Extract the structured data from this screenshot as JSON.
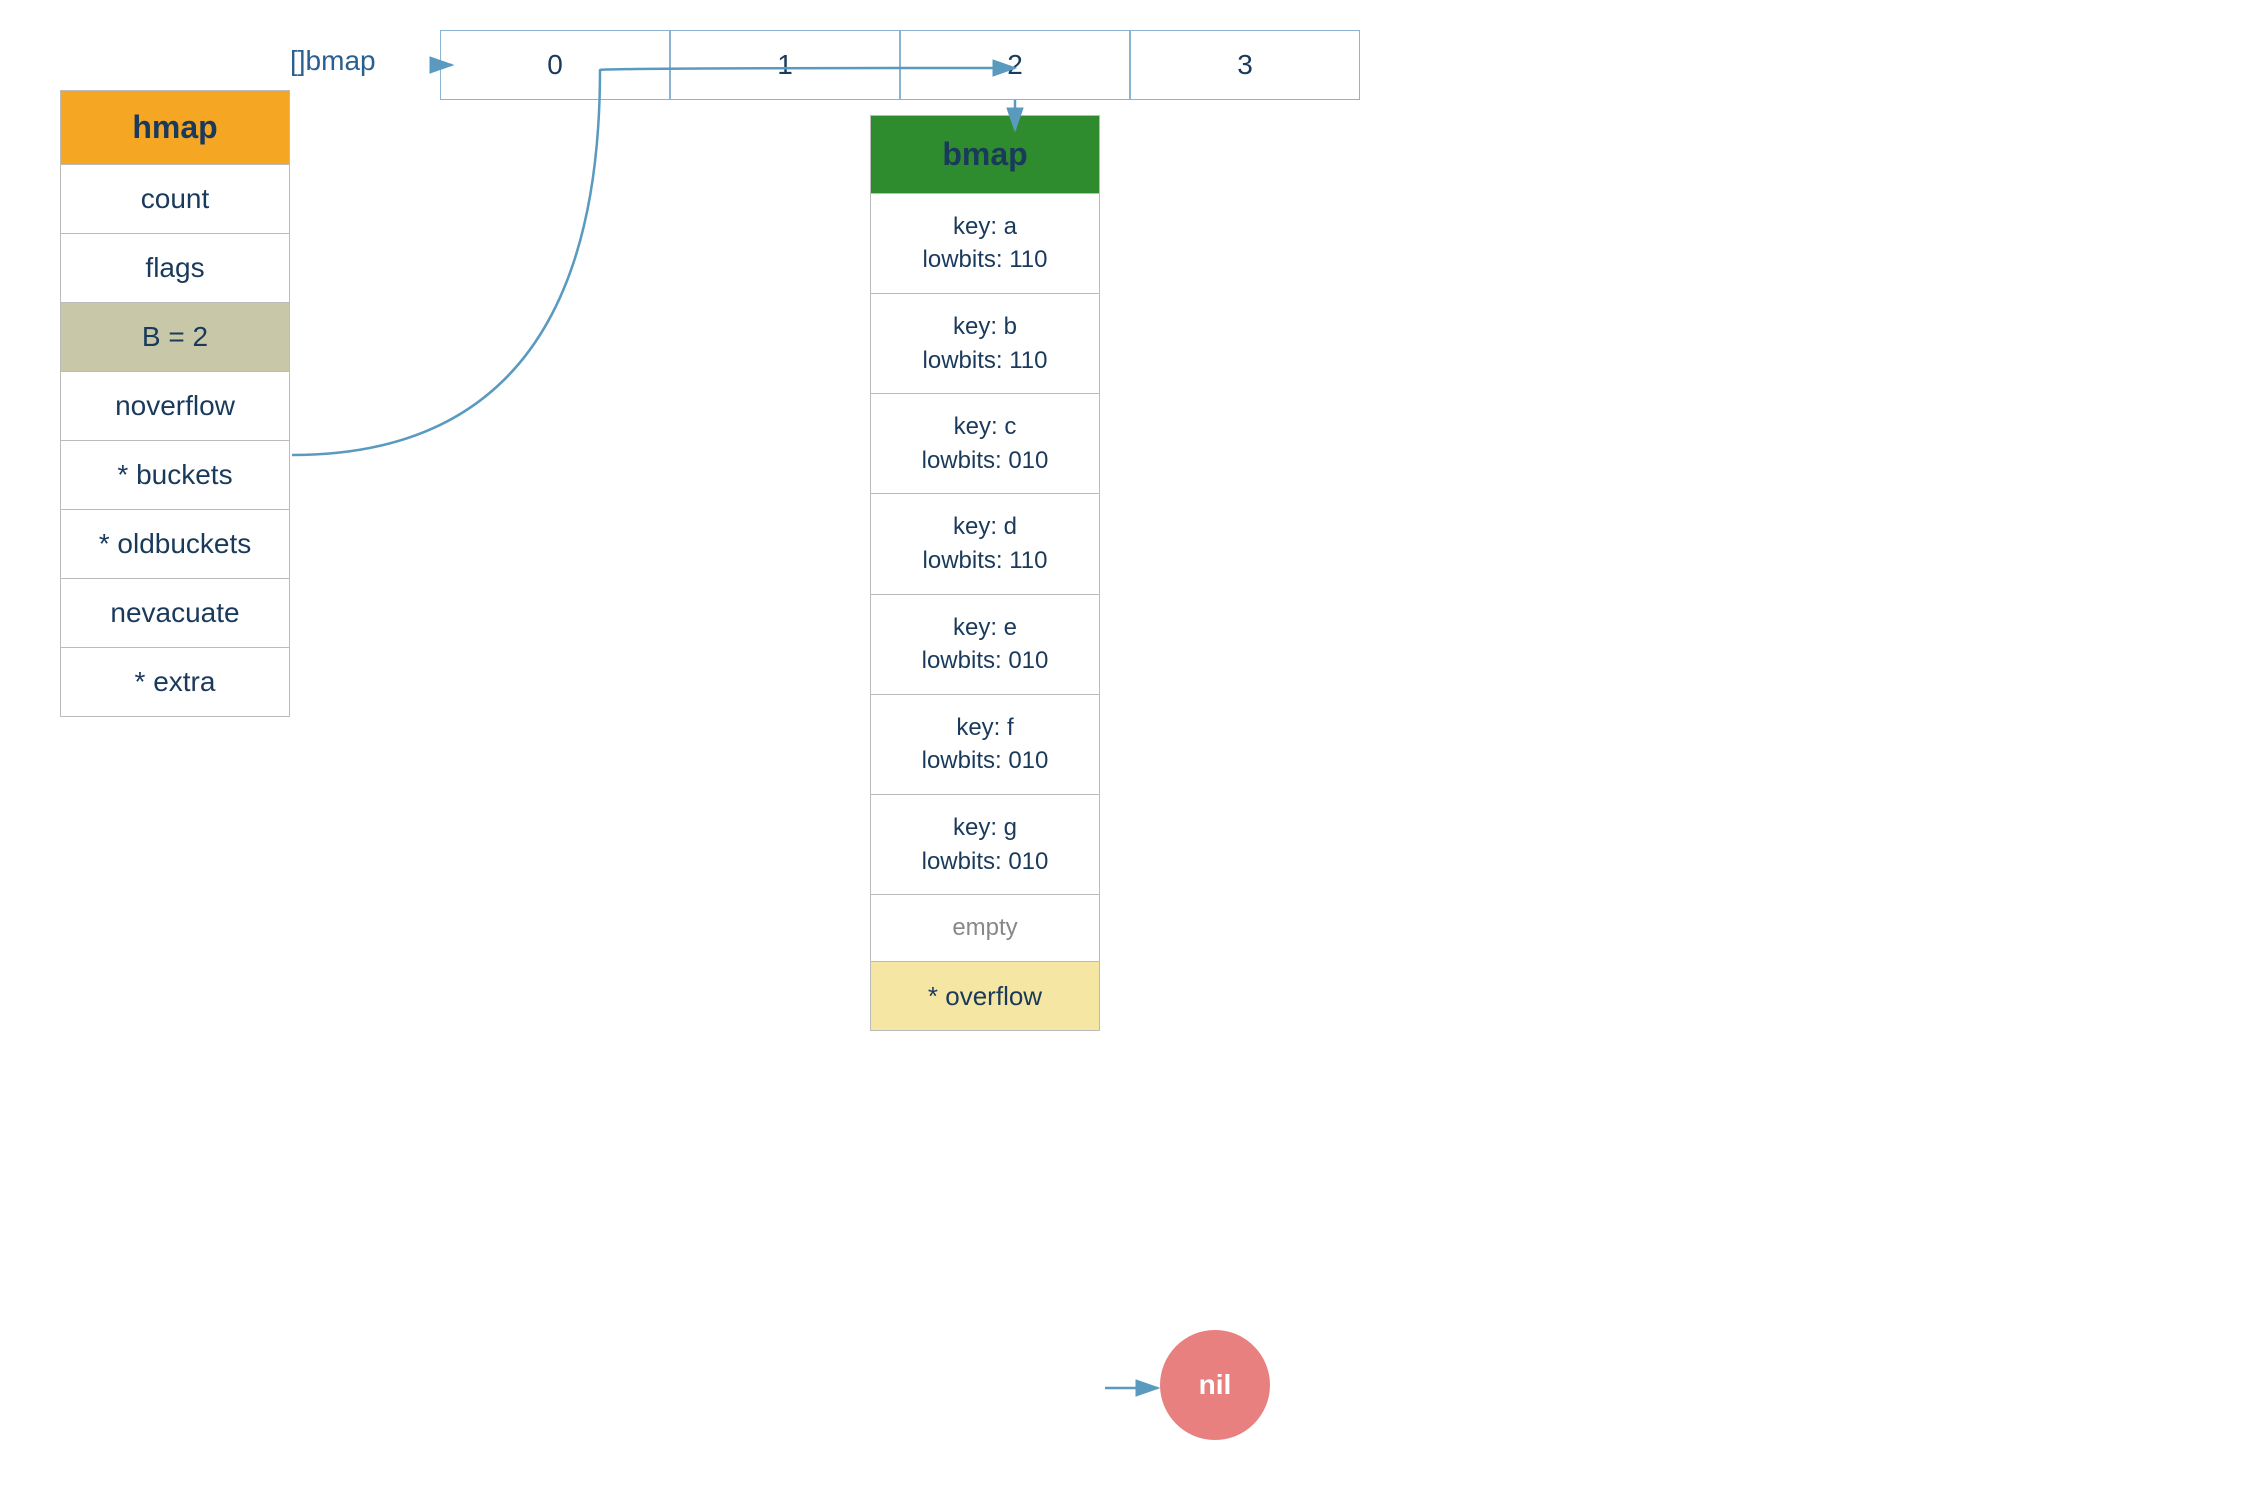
{
  "hmap": {
    "title": "hmap",
    "fields": [
      {
        "label": "count",
        "highlight": false
      },
      {
        "label": "flags",
        "highlight": false
      },
      {
        "label": "B = 2",
        "highlight": true
      },
      {
        "label": "noverflow",
        "highlight": false
      },
      {
        "label": "* buckets",
        "highlight": false
      },
      {
        "label": "* oldbuckets",
        "highlight": false
      },
      {
        "label": "nevacuate",
        "highlight": false
      },
      {
        "label": "* extra",
        "highlight": false
      }
    ]
  },
  "bmap_array": {
    "label": "[]bmap",
    "columns": [
      "0",
      "1",
      "2",
      "3"
    ]
  },
  "bmap_bucket": {
    "title": "bmap",
    "entries": [
      {
        "key": "a",
        "lowbits": "110"
      },
      {
        "key": "b",
        "lowbits": "110"
      },
      {
        "key": "c",
        "lowbits": "010"
      },
      {
        "key": "d",
        "lowbits": "110"
      },
      {
        "key": "e",
        "lowbits": "010"
      },
      {
        "key": "f",
        "lowbits": "010"
      },
      {
        "key": "g",
        "lowbits": "010"
      }
    ],
    "empty_label": "empty",
    "overflow_label": "* overflow"
  },
  "nil_label": "nil",
  "colors": {
    "orange": "#F5A623",
    "green": "#2e8b2e",
    "yellow_bg": "#f5e6a3",
    "gray_bg": "#c8c8a9",
    "blue_text": "#1a3a5c",
    "arrow_color": "#5a9abf",
    "nil_color": "#e88080"
  }
}
